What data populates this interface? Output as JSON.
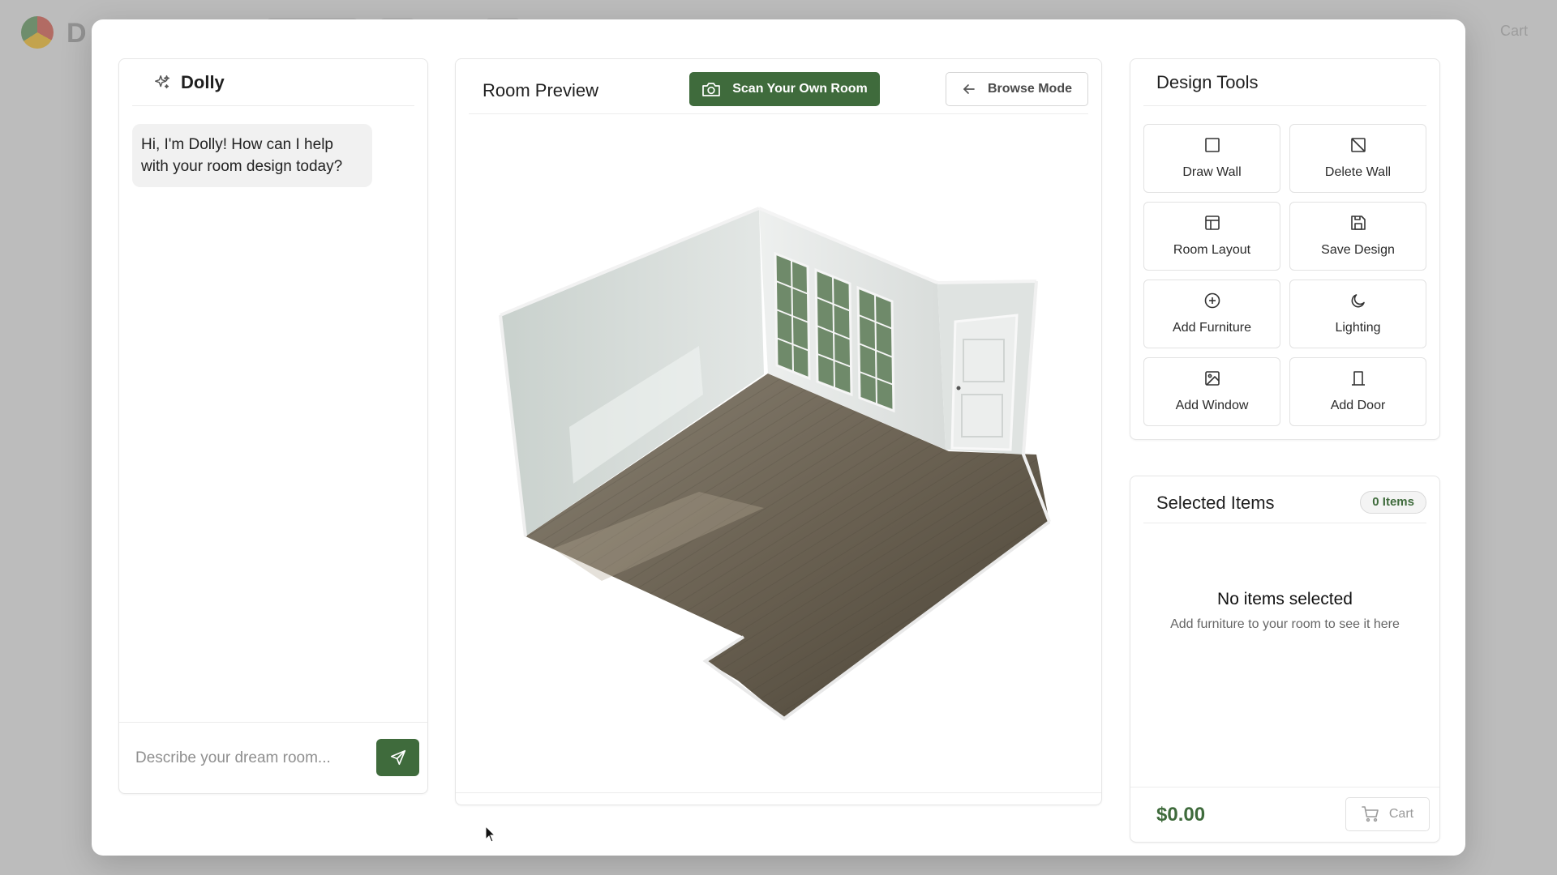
{
  "background": {
    "cart_label": "Cart"
  },
  "chat": {
    "title": "Dolly",
    "icon": "sparkles-icon",
    "messages": [
      {
        "from": "assistant",
        "text": "Hi, I'm Dolly! How can I help with your room design today?"
      }
    ],
    "input_placeholder": "Describe your dream room...",
    "input_value": "",
    "send_icon": "send-icon"
  },
  "preview": {
    "title": "Room Preview",
    "scan_button": "Scan Your Own Room",
    "scan_icon": "camera-icon",
    "browse_button": "Browse Mode",
    "browse_icon": "arrow-left-icon"
  },
  "tools": {
    "title": "Design Tools",
    "items": [
      {
        "label": "Draw Wall",
        "icon": "square-icon"
      },
      {
        "label": "Delete Wall",
        "icon": "square-slash-icon"
      },
      {
        "label": "Room Layout",
        "icon": "layout-icon"
      },
      {
        "label": "Save Design",
        "icon": "save-icon"
      },
      {
        "label": "Add Furniture",
        "icon": "plus-circle-icon"
      },
      {
        "label": "Lighting",
        "icon": "moon-icon"
      },
      {
        "label": "Add Window",
        "icon": "image-icon"
      },
      {
        "label": "Add Door",
        "icon": "door-icon"
      }
    ]
  },
  "selected": {
    "title": "Selected Items",
    "badge": "0 Items",
    "empty_title": "No items selected",
    "empty_subtitle": "Add furniture to your room to see it here",
    "total": "$0.00",
    "cart_button": "Cart"
  },
  "colors": {
    "accent": "#3f6b3c",
    "wall": "#dfe4e1",
    "floor": "#6a6152"
  }
}
